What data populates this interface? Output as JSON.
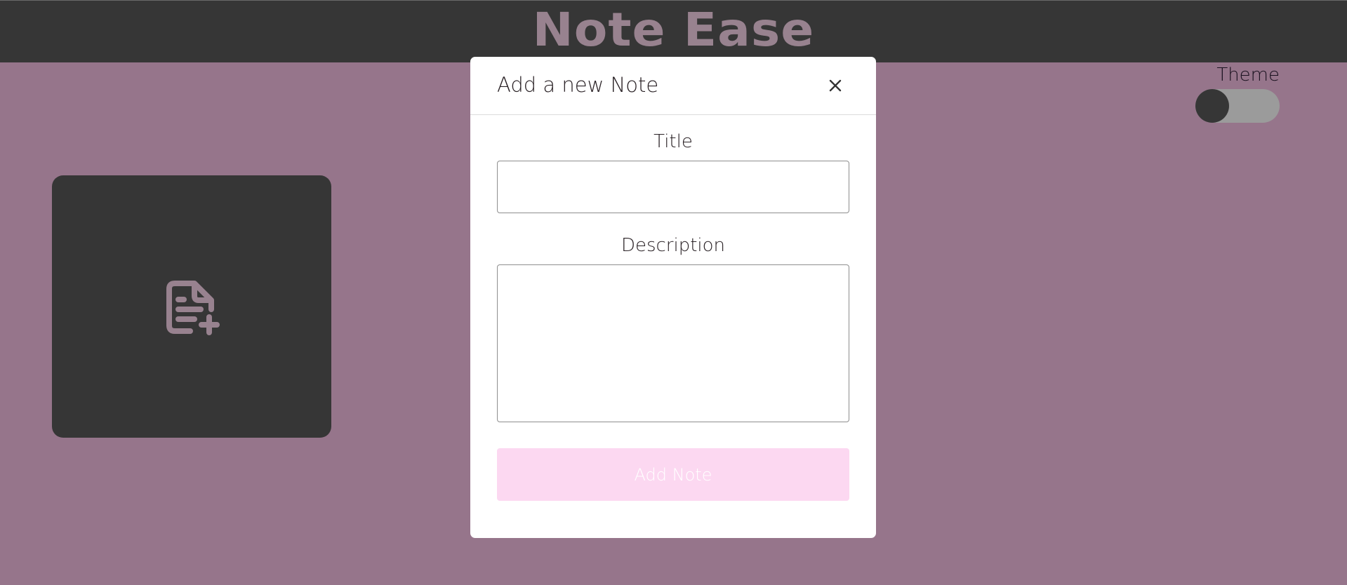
{
  "header": {
    "brand": "Note Ease"
  },
  "theme": {
    "label": "Theme",
    "is_dark": false
  },
  "add_card": {
    "icon": "file-plus-icon"
  },
  "modal": {
    "title": "Add a new Note",
    "close_icon": "close-icon",
    "title_field": {
      "label": "Title",
      "value": "",
      "placeholder": ""
    },
    "description_field": {
      "label": "Description",
      "value": "",
      "placeholder": ""
    },
    "submit_label": "Add Note"
  },
  "colors": {
    "background": "#96758b",
    "header": "#363636",
    "brand_text": "#98828f",
    "card": "#363636",
    "submit_button": "#fcd8f1",
    "toggle_track": "#9b9b9b"
  }
}
